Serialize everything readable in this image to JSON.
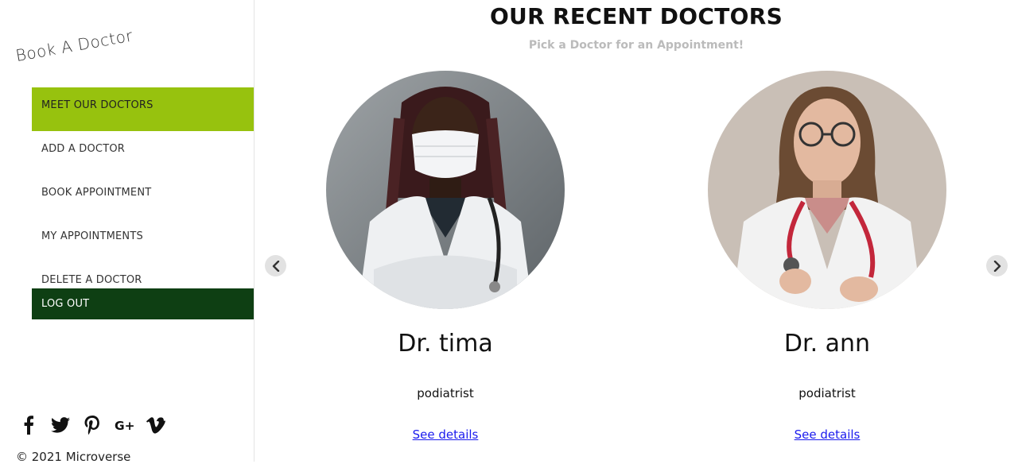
{
  "sidebar": {
    "brand": "Book A Doctor",
    "items": [
      {
        "label": "MEET OUR DOCTORS",
        "active": true
      },
      {
        "label": "ADD A DOCTOR"
      },
      {
        "label": "BOOK APPOINTMENT"
      },
      {
        "label": "MY APPOINTMENTS"
      },
      {
        "label": "DELETE A DOCTOR"
      },
      {
        "label": "LOG OUT"
      }
    ],
    "social_icons": [
      "facebook-icon",
      "twitter-icon",
      "pinterest-icon",
      "google-plus-icon",
      "vimeo-icon"
    ],
    "copyright": "© 2021 Microverse"
  },
  "main": {
    "title": "OUR RECENT DOCTORS",
    "subtitle": "Pick a Doctor for an Appointment!",
    "doctors": [
      {
        "name": "Dr. tima",
        "specialization": "podiatrist",
        "link": "See details"
      },
      {
        "name": "Dr. ann",
        "specialization": "podiatrist",
        "link": "See details"
      }
    ]
  },
  "colors": {
    "accent": "#97c20e",
    "logout": "#0e3f13",
    "link": "#1a1aee"
  }
}
